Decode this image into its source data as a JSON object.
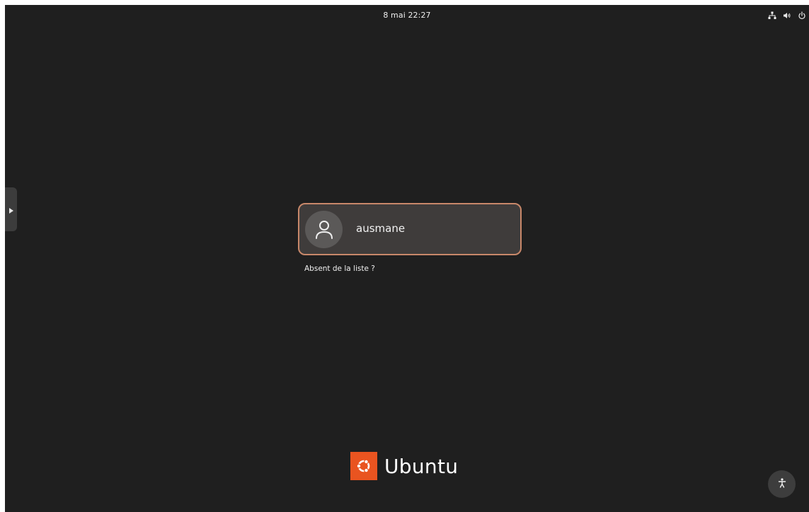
{
  "topbar": {
    "clock": "8 mai  22:27",
    "icons": [
      "network-icon",
      "volume-icon",
      "power-icon"
    ]
  },
  "side_panel": {
    "toggle_icon": "triangle-right-icon"
  },
  "login": {
    "user": {
      "name": "ausmane",
      "avatar_icon": "user-avatar-icon"
    },
    "not_listed_label": "Absent de la liste ?"
  },
  "branding": {
    "logo_icon": "ubuntu-circle-of-friends-icon",
    "name": "Ubuntu",
    "accent_color": "#e95420"
  },
  "accessibility": {
    "icon": "accessibility-icon"
  },
  "colors": {
    "background": "#1f1f1f",
    "card": "#3f3c3b",
    "card_border": "#c8886a",
    "text": "#f0f0f0"
  }
}
